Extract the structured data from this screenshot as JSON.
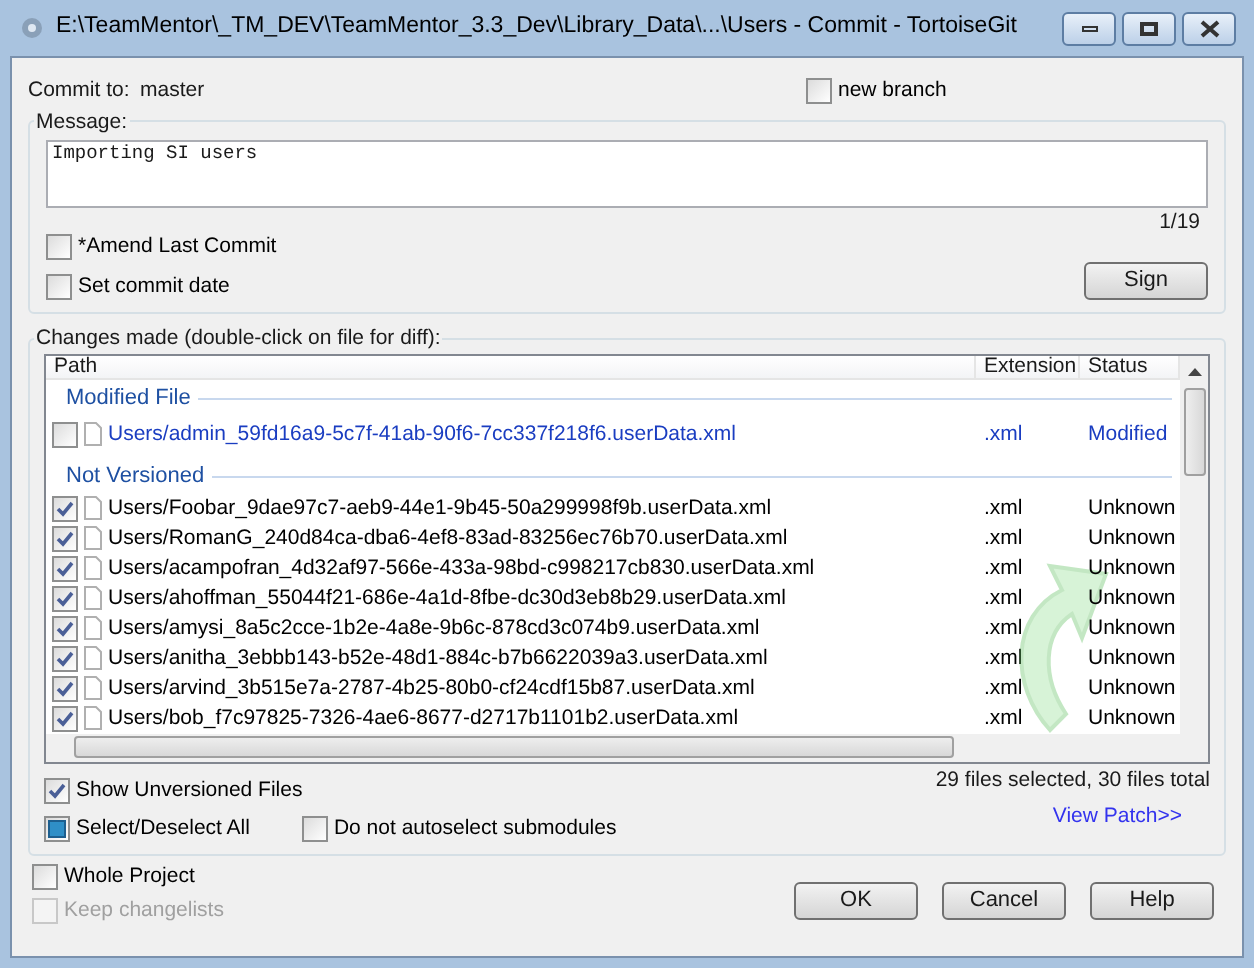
{
  "window": {
    "title": "E:\\TeamMentor\\_TM_DEV\\TeamMentor_3.3_Dev\\Library_Data\\...\\Users - Commit - TortoiseGit"
  },
  "commit_to": {
    "label": "Commit to:",
    "branch": "master"
  },
  "new_branch": {
    "label": "new branch",
    "checked": false
  },
  "message": {
    "label": "Message:",
    "value": "Importing SI users",
    "counter": "1/19"
  },
  "options": [
    {
      "label": "*Amend Last Commit",
      "checked": false
    },
    {
      "label": "Set commit date",
      "checked": false
    }
  ],
  "sign_button": "Sign",
  "changes": {
    "label": "Changes made (double-click on file for diff):",
    "columns": [
      "Path",
      "Extension",
      "Status"
    ],
    "groups": [
      {
        "title": "Modified File",
        "kind": "modified",
        "rows": [
          {
            "path": "Users/admin_59fd16a9-5c7f-41ab-90f6-7cc337f218f6.userData.xml",
            "extension": ".xml",
            "status": "Modified",
            "checked": false
          }
        ]
      },
      {
        "title": "Not Versioned",
        "kind": "unversioned",
        "rows": [
          {
            "path": "Users/Foobar_9dae97c7-aeb9-44e1-9b45-50a299998f9b.userData.xml",
            "extension": ".xml",
            "status": "Unknown",
            "checked": true
          },
          {
            "path": "Users/RomanG_240d84ca-dba6-4ef8-83ad-83256ec76b70.userData.xml",
            "extension": ".xml",
            "status": "Unknown",
            "checked": true
          },
          {
            "path": "Users/acampofran_4d32af97-566e-433a-98bd-c998217cb830.userData.xml",
            "extension": ".xml",
            "status": "Unknown",
            "checked": true
          },
          {
            "path": "Users/ahoffman_55044f21-686e-4a1d-8fbe-dc30d3eb8b29.userData.xml",
            "extension": ".xml",
            "status": "Unknown",
            "checked": true
          },
          {
            "path": "Users/amysi_8a5c2cce-1b2e-4a8e-9b6c-878cd3c074b9.userData.xml",
            "extension": ".xml",
            "status": "Unknown",
            "checked": true
          },
          {
            "path": "Users/anitha_3ebbb143-b52e-48d1-884c-b7b6622039a3.userData.xml",
            "extension": ".xml",
            "status": "Unknown",
            "checked": true
          },
          {
            "path": "Users/arvind_3b515e7a-2787-4b25-80b0-cf24cdf15b87.userData.xml",
            "extension": ".xml",
            "status": "Unknown",
            "checked": true
          },
          {
            "path": "Users/bob_f7c97825-7326-4ae6-8677-d2717b1101b2.userData.xml",
            "extension": ".xml",
            "status": "Unknown",
            "checked": true
          }
        ]
      }
    ]
  },
  "show_unversioned": {
    "label": "Show Unversioned Files",
    "checked": true
  },
  "select_all": {
    "label": "Select/Deselect All",
    "indeterminate": true
  },
  "no_autoselect": {
    "label": "Do not autoselect submodules",
    "checked": false
  },
  "summary": "29 files selected, 30 files total",
  "view_patch": "View Patch>>",
  "whole_project": {
    "label": "Whole Project",
    "checked": false,
    "disabled": false
  },
  "keep_changelists": {
    "label": "Keep changelists",
    "checked": false,
    "disabled": true
  },
  "buttons": [
    "OK",
    "Cancel",
    "Help"
  ]
}
